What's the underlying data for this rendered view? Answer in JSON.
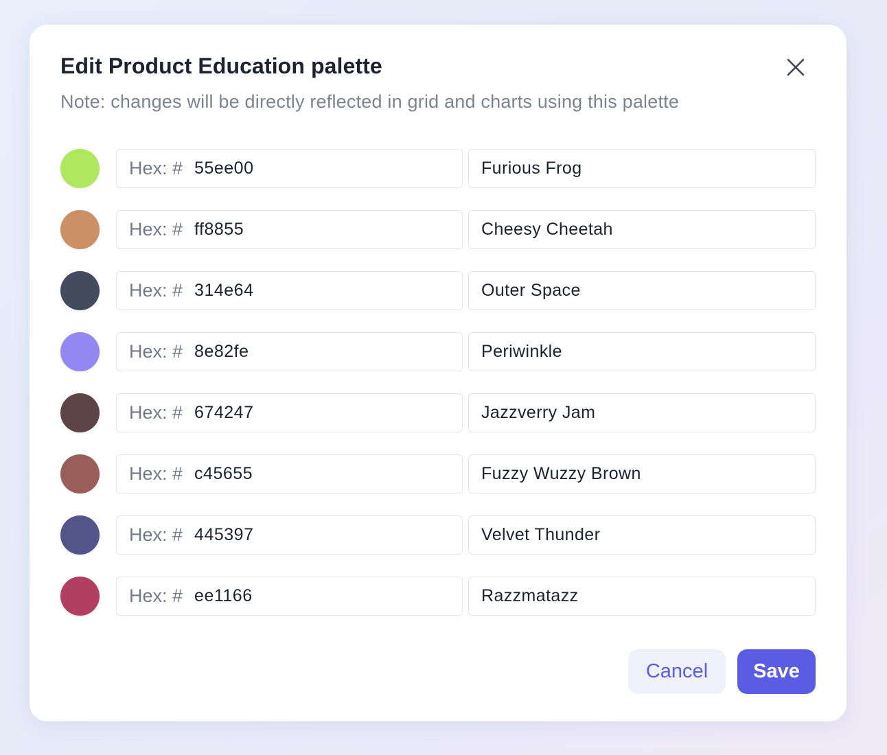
{
  "modal": {
    "title": "Edit Product Education palette",
    "note": "Note: changes will be directly reflected in grid and charts using this palette",
    "hex_prefix": "Hex: #",
    "rows": [
      {
        "swatch_color": "#aee85c",
        "hex": "55ee00",
        "name": "Furious Frog"
      },
      {
        "swatch_color": "#cd8f64",
        "hex": "ff8855",
        "name": "Cheesy Cheetah"
      },
      {
        "swatch_color": "#434b5e",
        "hex": "314e64",
        "name": "Outer Space"
      },
      {
        "swatch_color": "#9388f2",
        "hex": "8e82fe",
        "name": "Periwinkle"
      },
      {
        "swatch_color": "#5d4446",
        "hex": "674247",
        "name": "Jazzverry Jam"
      },
      {
        "swatch_color": "#995e58",
        "hex": "c45655",
        "name": "Fuzzy Wuzzy Brown"
      },
      {
        "swatch_color": "#52548a",
        "hex": "445397",
        "name": "Velvet Thunder"
      },
      {
        "swatch_color": "#b23e64",
        "hex": "ee1166",
        "name": "Razzmatazz"
      }
    ],
    "cancel_label": "Cancel",
    "save_label": "Save",
    "close_icon": "close-icon"
  },
  "colors": {
    "accent": "#5a5ce3",
    "cancel_bg": "#eef1fa",
    "title_text": "#1d2230",
    "note_text": "#7d8390"
  }
}
